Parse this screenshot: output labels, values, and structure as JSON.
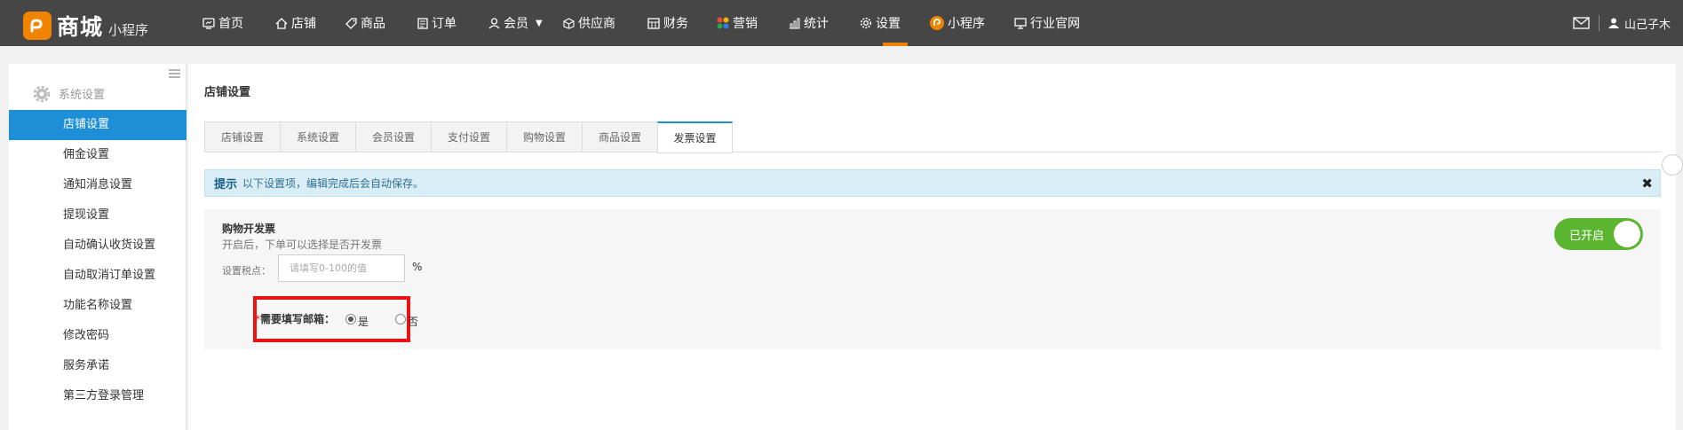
{
  "brand": {
    "name": "商城",
    "sub": "小程序"
  },
  "nav": [
    {
      "label": "首页",
      "icon": "home-frame-icon"
    },
    {
      "label": "店铺",
      "icon": "house-icon"
    },
    {
      "label": "商品",
      "icon": "tag-icon"
    },
    {
      "label": "订单",
      "icon": "document-icon"
    },
    {
      "label": "会员",
      "icon": "user-icon"
    },
    {
      "label": "供应商",
      "icon": "cube-icon"
    },
    {
      "label": "财务",
      "icon": "calculator-icon"
    },
    {
      "label": "营销",
      "icon": "colorful-grid-icon"
    },
    {
      "label": "统计",
      "icon": "bar-chart-icon"
    },
    {
      "label": "设置",
      "icon": "gear-icon"
    },
    {
      "label": "小程序",
      "icon": "mini-program-icon"
    },
    {
      "label": "行业官网",
      "icon": "monitor-icon"
    }
  ],
  "user": {
    "name": "山己子木"
  },
  "sidebar": {
    "section": "系统设置",
    "items": [
      {
        "label": "店铺设置"
      },
      {
        "label": "佣金设置"
      },
      {
        "label": "通知消息设置"
      },
      {
        "label": "提现设置"
      },
      {
        "label": "自动确认收货设置"
      },
      {
        "label": "自动取消订单设置"
      },
      {
        "label": "功能名称设置"
      },
      {
        "label": "修改密码"
      },
      {
        "label": "服务承诺"
      },
      {
        "label": "第三方登录管理"
      }
    ]
  },
  "main": {
    "title": "店铺设置",
    "tabs": [
      {
        "label": "店铺设置"
      },
      {
        "label": "系统设置"
      },
      {
        "label": "会员设置"
      },
      {
        "label": "支付设置"
      },
      {
        "label": "购物设置"
      },
      {
        "label": "商品设置"
      },
      {
        "label": "发票设置"
      }
    ],
    "notice": {
      "title": "提示",
      "text": "以下设置项，编辑完成后会自动保存。",
      "close": "✖"
    },
    "invoice": {
      "title": "购物开发票",
      "desc": "开启后，下单可以选择是否开发票",
      "tax_label": "设置税点：",
      "tax_placeholder": "请填写0-100的值",
      "tax_value": "",
      "tax_unit": "%",
      "email_required_mark": "*",
      "email_label": "需要填写邮箱：",
      "option_yes": "是",
      "option_no": "否",
      "email_selected": "是",
      "toggle_label": "已开启",
      "enabled": true
    }
  },
  "colors": {
    "accent": "#1e8ed6",
    "brand": "#f08300",
    "toggle": "#5cb531",
    "highlight": "#ee1111"
  }
}
